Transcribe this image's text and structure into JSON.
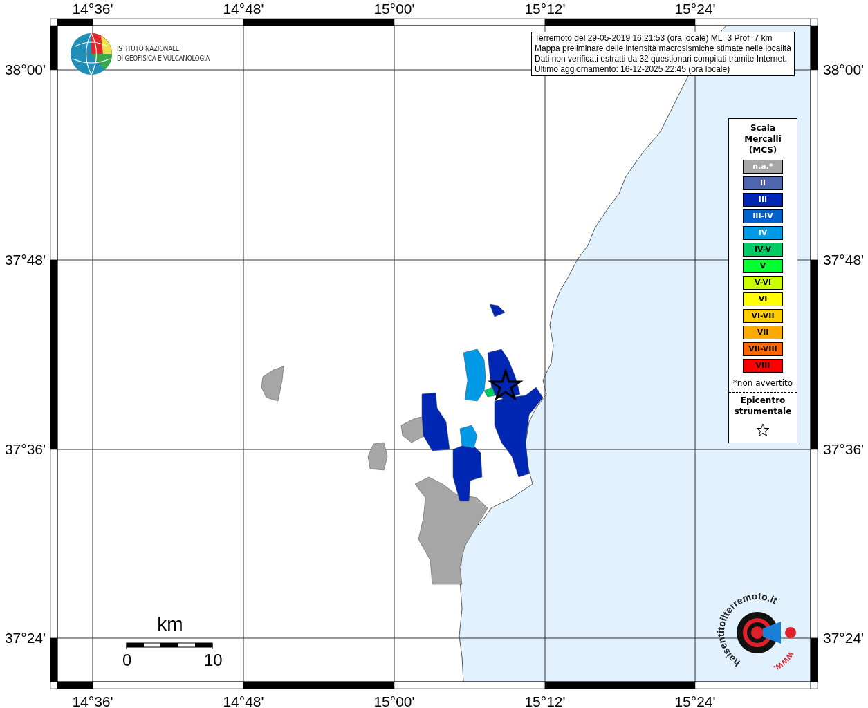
{
  "info_box": {
    "lines": [
      "Terremoto del 29-05-2019 16:21:53 (ora locale) ML=3 Prof=7 km",
      "Mappa preliminare delle intensità macrosismiche stimate nelle località",
      "Dati non verificati estratti da 32 questionari compilati tramite Internet.",
      "Ultimo aggiornamento: 16-12-2025 22:45 (ora locale)"
    ]
  },
  "institute_logo": {
    "lines": [
      "ISTITUTO NAZIONALE",
      "DI GEOFISICA E VULCANOLOGIA"
    ]
  },
  "map": {
    "x_labels_top": [
      "14°36'",
      "14°48'",
      "15°00'",
      "15°12'",
      "15°24'"
    ],
    "x_labels_bottom": [
      "14°36'",
      "14°48'",
      "15°00'",
      "15°12'",
      "15°24'"
    ],
    "y_labels_left": [
      "38°00'",
      "37°48'",
      "37°36'",
      "37°24'"
    ],
    "y_labels_right": [
      "38°00'",
      "37°48'",
      "37°36'",
      "37°24'"
    ]
  },
  "legend": {
    "title_lines": [
      "Scala",
      "Mercalli",
      "(MCS)"
    ],
    "items": [
      {
        "label": "n.a.*",
        "color": "#a6a6a6",
        "kind": "light"
      },
      {
        "label": "II",
        "color": "#4f65ad",
        "kind": "light"
      },
      {
        "label": "III",
        "color": "#0026b4",
        "kind": "light"
      },
      {
        "label": "III-IV",
        "color": "#0061cc",
        "kind": "light"
      },
      {
        "label": "IV",
        "color": "#0099e6",
        "kind": "light"
      },
      {
        "label": "IV-V",
        "color": "#00cc66",
        "kind": "dark"
      },
      {
        "label": "V",
        "color": "#00ff33",
        "kind": "dark"
      },
      {
        "label": "V-VI",
        "color": "#ccff00",
        "kind": "dark"
      },
      {
        "label": "VI",
        "color": "#ffff00",
        "kind": "dark"
      },
      {
        "label": "VI-VII",
        "color": "#ffcc00",
        "kind": "dark"
      },
      {
        "label": "VII",
        "color": "#ffaa00",
        "kind": "dark"
      },
      {
        "label": "VII-VIII",
        "color": "#ff6600",
        "kind": "dark"
      },
      {
        "label": "VIII",
        "color": "#ff0000",
        "kind": "dark"
      }
    ],
    "footnote": "*non avvertito",
    "epicenter_lines": [
      "Epicentro",
      "strumentale"
    ]
  },
  "scale_bar": {
    "unit": "km",
    "min": "0",
    "max": "10"
  },
  "site_logo": {
    "text": "haisentitoilterremoto.it",
    "prefix": "www."
  }
}
